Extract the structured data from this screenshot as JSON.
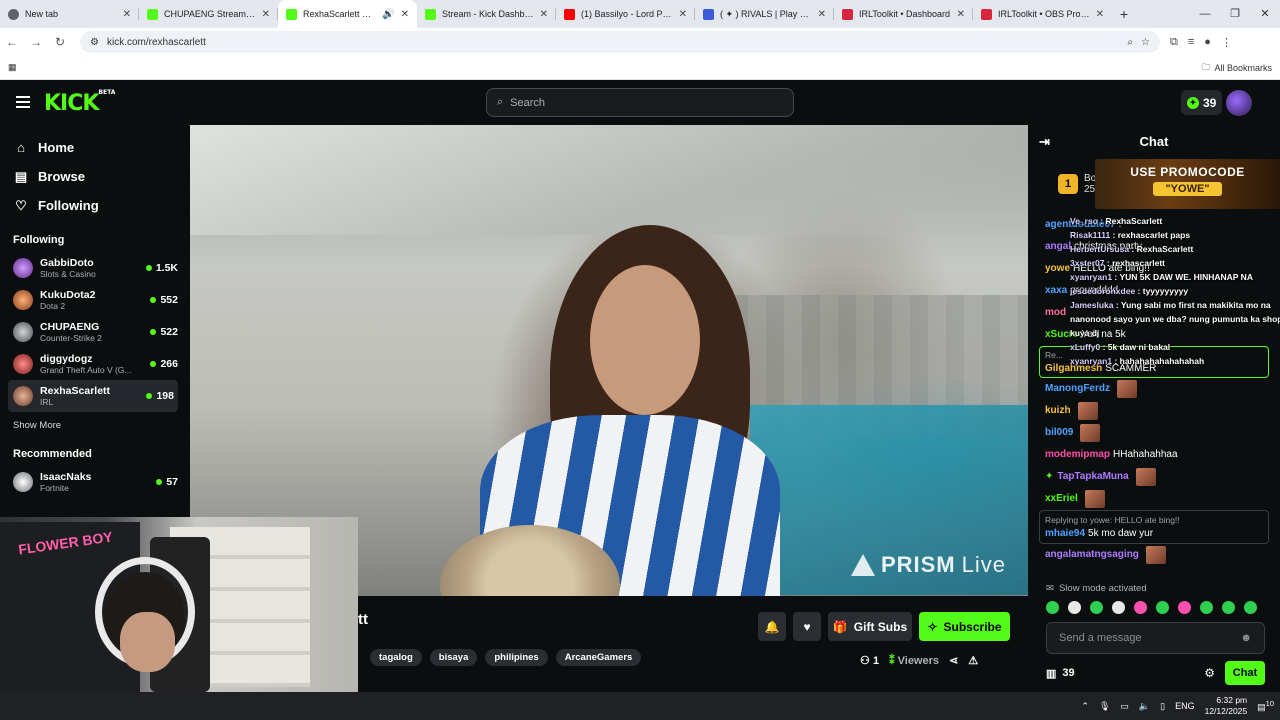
{
  "browser": {
    "tabs": [
      {
        "title": "New tab",
        "color": "#5f6368"
      },
      {
        "title": "CHUPAENG Stream - Wat",
        "color": "#53fc18"
      },
      {
        "title": "RexhaScarlett Stream",
        "color": "#53fc18"
      },
      {
        "title": "Stream - Kick Dashboard",
        "color": "#53fc18"
      },
      {
        "title": "(1) Bassilyo - Lord Patawad",
        "color": "#ff0000"
      },
      {
        "title": "( ✦ ) RIVALS | Play on Rob",
        "color": "#3b5bdb"
      },
      {
        "title": "IRLToolkit • Dashboard",
        "color": "#d7263d"
      },
      {
        "title": "IRLToolkit • OBS Profiles",
        "color": "#d7263d"
      }
    ],
    "url": "kick.com/rexhascarlett",
    "bookmarks_label": "All Bookmarks"
  },
  "header": {
    "logo": "KICK",
    "logo_badge": "BETA",
    "search_placeholder": "Search",
    "points": "39"
  },
  "sidebar": {
    "nav": [
      {
        "label": "Home",
        "icon": "home-icon"
      },
      {
        "label": "Browse",
        "icon": "browse-icon"
      },
      {
        "label": "Following",
        "icon": "heart-icon"
      }
    ],
    "following_title": "Following",
    "following": [
      {
        "name": "GabbiDoto",
        "category": "Slots & Casino",
        "viewers": "1.5K",
        "color": "#b05cff"
      },
      {
        "name": "KukuDota2",
        "category": "Dota 2",
        "viewers": "552",
        "color": "#ff7a3d"
      },
      {
        "name": "CHUPAENG",
        "category": "Counter-Strike 2",
        "viewers": "522",
        "color": "#8a8d91"
      },
      {
        "name": "diggydogz",
        "category": "Grand Theft Auto V (G...",
        "viewers": "266",
        "color": "#e34b4b"
      },
      {
        "name": "RexhaScarlett",
        "category": "IRL",
        "viewers": "198",
        "color": "#c08a6e"
      }
    ],
    "show_more": "Show More",
    "recommended_title": "Recommended",
    "recommended": [
      {
        "name": "IsaacNaks",
        "category": "Fortnite",
        "viewers": "57",
        "color": "#e8e8e8"
      }
    ]
  },
  "stream": {
    "watermark": "PRISM",
    "watermark_suffix": "Live",
    "title_fragment": "tt",
    "tags": [
      "tagalog",
      "bisaya",
      "philipines",
      "ArcaneGamers"
    ],
    "gift_label": "Gift Subs",
    "subscribe_label": "Subscribe",
    "viewer_count": "1",
    "viewers_label": "Viewers",
    "cam_text": "FLOWER BOY"
  },
  "chat": {
    "title": "Chat",
    "pinned_badge": "1",
    "pinned_name": "Bo",
    "pinned_sub": "25",
    "promo_line1": "USE PROMOCODE",
    "promo_line2": "\"YOWE\"",
    "messages": [
      {
        "user": "agentdouble07",
        "text": ":",
        "color": "#4fa3ff"
      },
      {
        "user": "angal",
        "text": "christmas party",
        "color": "#b07cff"
      },
      {
        "user": "yowe",
        "text": "HELLO ate bing!!",
        "color": "#f5c242"
      },
      {
        "user": "xaxa",
        "text": "groundddd",
        "color": "#4fa3ff"
      },
      {
        "user": "mod",
        "text": "",
        "color": "#ff6b9d"
      },
      {
        "user": "xSucre",
        "text": "Yah na 5k",
        "color": "#53fc18"
      }
    ],
    "highlight": {
      "reply": "Re...",
      "user": "Gilgahmesh",
      "text": "SCAMMER",
      "color": "#f5c242"
    },
    "messages2": [
      {
        "user": "ManongFerdz",
        "text": "",
        "color": "#4fa3ff",
        "emote": true
      },
      {
        "user": "kuizh",
        "text": "",
        "color": "#f5c242",
        "emote": true
      },
      {
        "user": "bil009",
        "text": "",
        "color": "#4fa3ff",
        "emote": true
      },
      {
        "user": "modemipmap",
        "text": "HHahahahhaa",
        "color": "#ff4fa6",
        "emote": false
      },
      {
        "user": "TapTapkaMuna",
        "text": "",
        "color": "#b07cff",
        "emote": true
      },
      {
        "user": "xxEriel",
        "text": "",
        "color": "#53fc18",
        "emote": true
      }
    ],
    "reply": {
      "reply_to": "Replying to yowe: HELLO ate bing!!",
      "user": "mhaie94",
      "text": "5k mo daw yur",
      "color": "#4fa3ff"
    },
    "last": {
      "user": "angalamatngsaging",
      "text": "",
      "color": "#b07cff"
    },
    "slow_mode": "Slow mode activated",
    "input_placeholder": "Send a message",
    "points": "39",
    "chat_button": "Chat"
  },
  "overlay_chat": [
    {
      "user": "Ve_rso",
      "text": "RexhaScarlett"
    },
    {
      "user": "Risak1111",
      "text": "rexhascarlet paps"
    },
    {
      "user": "HerbertUrsusa",
      "text": "RexhaScarlett"
    },
    {
      "user": "3xster07",
      "text": "rexhascarlett"
    },
    {
      "user": "xyanryan1",
      "text": "YUN 5K DAW WE. HINHANAP NA"
    },
    {
      "user": "jesdedoronxdee",
      "text": "tyyyyyyyyy"
    },
    {
      "user": "Jamesluka",
      "text": "Yung sabi mo first na makikita mo na"
    },
    {
      "user": "",
      "text": "nanonood sayo yun we dba? nung pumunta ka shop ni"
    },
    {
      "user": "",
      "text": "kuya dj"
    },
    {
      "user": "xLuffy0",
      "text": "5k daw ni bakal"
    },
    {
      "user": "xyanryan1",
      "text": "hahahahahahahahah"
    }
  ],
  "taskbar": {
    "lang": "ENG",
    "time": "6:32 pm",
    "date": "12/12/2025",
    "notif": "10"
  }
}
